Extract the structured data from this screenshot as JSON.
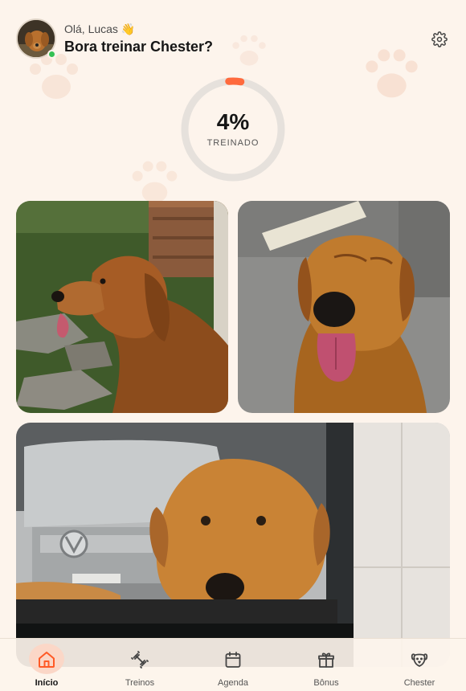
{
  "header": {
    "greeting": "Olá, Lucas 👋",
    "title": "Bora treinar Chester?"
  },
  "progress": {
    "percent_label": "4%",
    "percent": 0.04,
    "caption": "TREINADO"
  },
  "colors": {
    "background": "#fdf4ec",
    "accent": "#ff6a3d",
    "ring_track": "#e6e1dc",
    "online": "#35c154"
  },
  "tabs": [
    {
      "label": "Início",
      "icon": "home-icon",
      "active": true
    },
    {
      "label": "Treinos",
      "icon": "dumbbell-icon",
      "active": false
    },
    {
      "label": "Agenda",
      "icon": "calendar-icon",
      "active": false
    },
    {
      "label": "Bônus",
      "icon": "gift-icon",
      "active": false
    },
    {
      "label": "Chester",
      "icon": "dog-face-icon",
      "active": false
    }
  ]
}
